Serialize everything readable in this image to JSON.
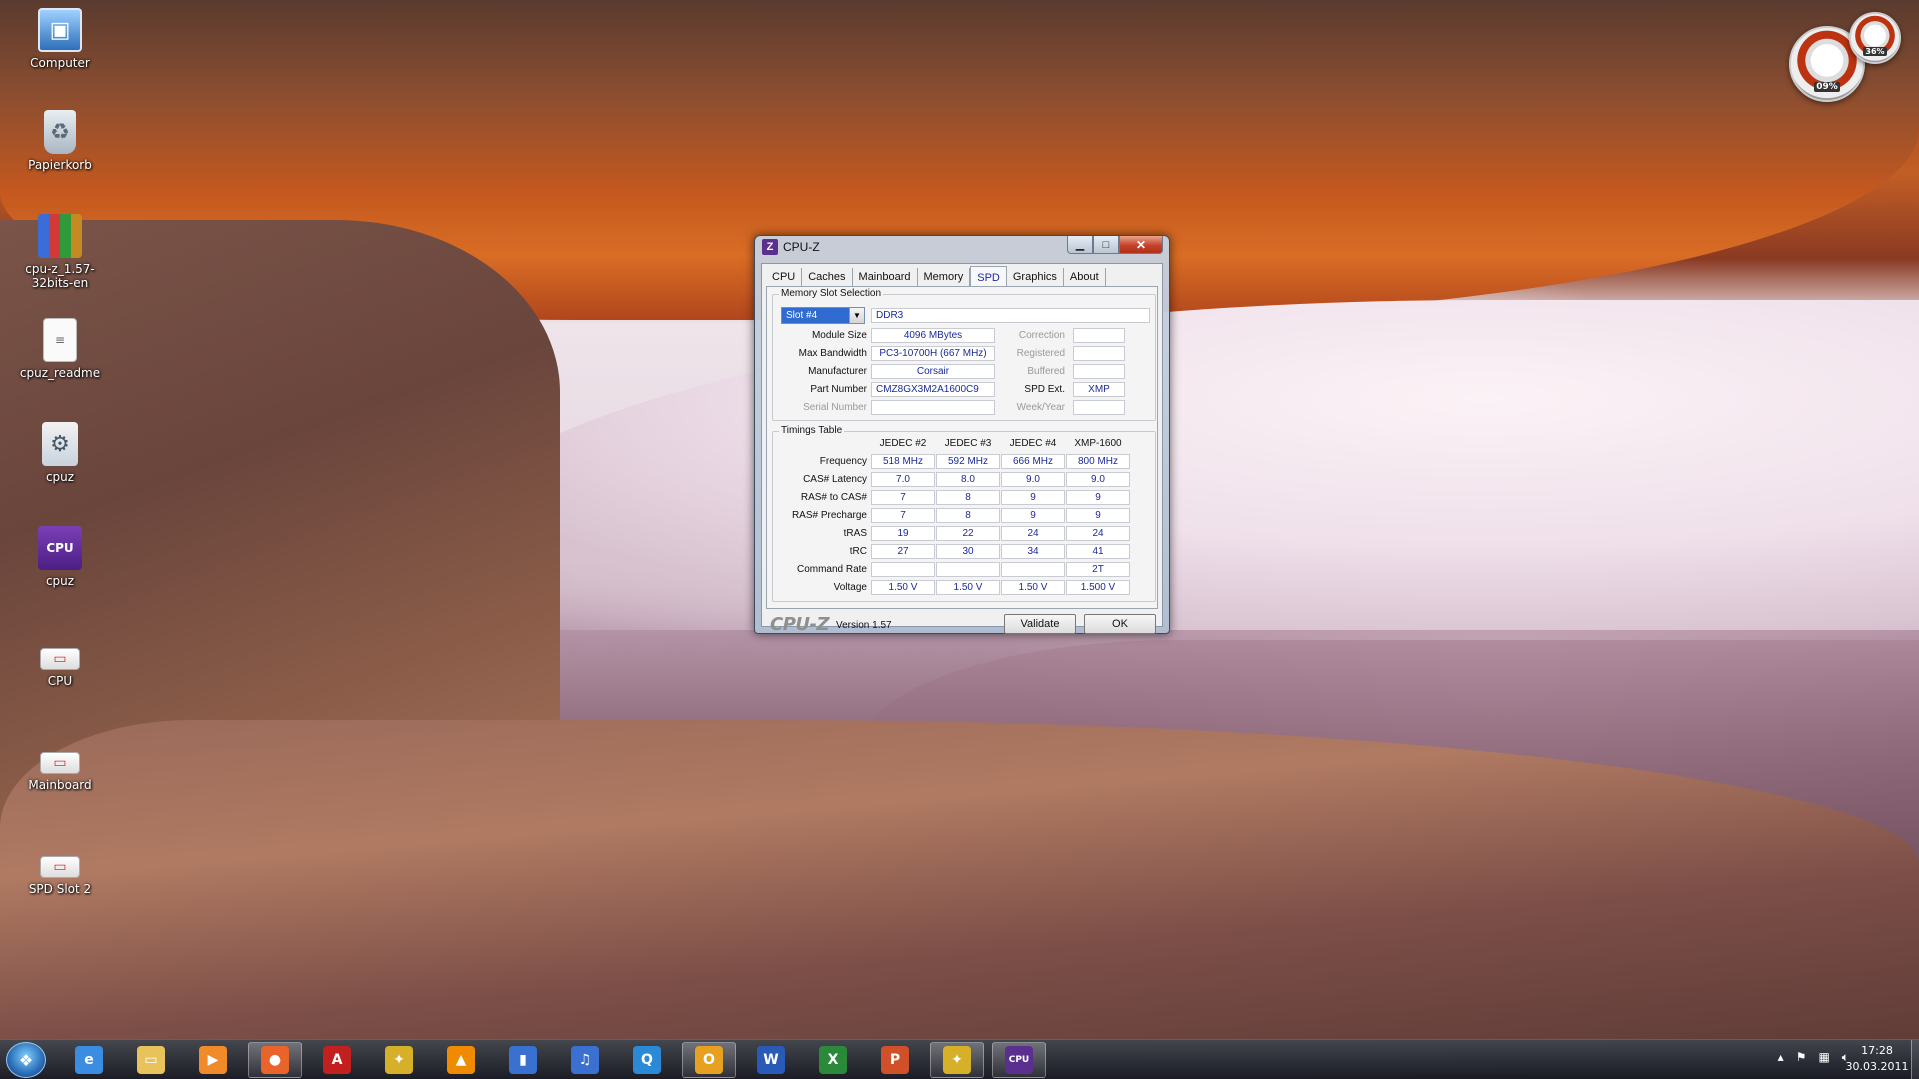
{
  "desktop": {
    "icons": [
      {
        "label": "Computer",
        "icon": "computer-icon"
      },
      {
        "label": "Papierkorb",
        "icon": "recycle-bin-icon"
      },
      {
        "label": "cpu-z_1.57-32bits-en",
        "icon": "winrar-archive-icon"
      },
      {
        "label": "cpuz_readme",
        "icon": "text-document-icon"
      },
      {
        "label": "cpuz",
        "icon": "settings-file-icon"
      },
      {
        "label": "cpuz",
        "icon": "cpuz-app-icon"
      },
      {
        "label": "CPU",
        "icon": "image-shortcut-icon"
      },
      {
        "label": "Mainboard",
        "icon": "image-shortcut-icon"
      },
      {
        "label": "SPD Slot 2",
        "icon": "image-shortcut-icon"
      }
    ]
  },
  "gadget": {
    "cpu_value": "09%",
    "mem_value": "36%"
  },
  "window": {
    "title": "CPU-Z",
    "icon_letter": "Z",
    "tabs": [
      {
        "label": "CPU",
        "active": false
      },
      {
        "label": "Caches",
        "active": false
      },
      {
        "label": "Mainboard",
        "active": false
      },
      {
        "label": "Memory",
        "active": false
      },
      {
        "label": "SPD",
        "active": true
      },
      {
        "label": "Graphics",
        "active": false
      },
      {
        "label": "About",
        "active": false
      }
    ],
    "slot_section": {
      "title": "Memory Slot Selection",
      "selected_slot": "Slot #4",
      "memory_type": "DDR3",
      "labels": {
        "module_size": "Module Size",
        "max_bandwidth": "Max Bandwidth",
        "manufacturer": "Manufacturer",
        "part_number": "Part Number",
        "serial_number": "Serial Number",
        "correction": "Correction",
        "registered": "Registered",
        "buffered": "Buffered",
        "spd_ext": "SPD Ext.",
        "week_year": "Week/Year"
      },
      "values": {
        "module_size": "4096 MBytes",
        "max_bandwidth": "PC3-10700H (667 MHz)",
        "manufacturer": "Corsair",
        "part_number": "CMZ8GX3M2A1600C9",
        "serial_number": "",
        "correction": "",
        "registered": "",
        "buffered": "",
        "spd_ext": "XMP",
        "week_year": ""
      }
    },
    "timings": {
      "title": "Timings Table",
      "columns": [
        "JEDEC #2",
        "JEDEC #3",
        "JEDEC #4",
        "XMP-1600"
      ],
      "rows": [
        {
          "label": "Frequency",
          "values": [
            "518 MHz",
            "592 MHz",
            "666 MHz",
            "800 MHz"
          ]
        },
        {
          "label": "CAS# Latency",
          "values": [
            "7.0",
            "8.0",
            "9.0",
            "9.0"
          ]
        },
        {
          "label": "RAS# to CAS#",
          "values": [
            "7",
            "8",
            "9",
            "9"
          ]
        },
        {
          "label": "RAS# Precharge",
          "values": [
            "7",
            "8",
            "9",
            "9"
          ]
        },
        {
          "label": "tRAS",
          "values": [
            "19",
            "22",
            "24",
            "24"
          ]
        },
        {
          "label": "tRC",
          "values": [
            "27",
            "30",
            "34",
            "41"
          ]
        },
        {
          "label": "Command Rate",
          "values": [
            "",
            "",
            "",
            "2T"
          ]
        },
        {
          "label": "Voltage",
          "values": [
            "1.50 V",
            "1.50 V",
            "1.50 V",
            "1.500 V"
          ]
        }
      ]
    },
    "footer": {
      "logo": "CPU-Z",
      "version": "Version 1.57",
      "validate_label": "Validate",
      "ok_label": "OK"
    }
  },
  "taskbar": {
    "items": [
      {
        "icon": "internet-explorer-icon",
        "glyph": "e",
        "color": "#3a8de0",
        "open": false
      },
      {
        "icon": "windows-explorer-icon",
        "glyph": "▭",
        "color": "#e8c25a",
        "open": false
      },
      {
        "icon": "media-player-icon",
        "glyph": "▶",
        "color": "#f08a2a",
        "open": false
      },
      {
        "icon": "firefox-icon",
        "glyph": "●",
        "color": "#e8642a",
        "open": true
      },
      {
        "icon": "acrobat-reader-icon",
        "glyph": "A",
        "color": "#c21f1f",
        "open": false
      },
      {
        "icon": "tool-app-icon",
        "glyph": "✦",
        "color": "#d7b02a",
        "open": false
      },
      {
        "icon": "vlc-icon",
        "glyph": "▲",
        "color": "#f08a00",
        "open": false
      },
      {
        "icon": "app-icon",
        "glyph": "▮",
        "color": "#3a70d0",
        "open": false
      },
      {
        "icon": "itunes-icon",
        "glyph": "♫",
        "color": "#3a70d0",
        "open": false
      },
      {
        "icon": "search-app-icon",
        "glyph": "Q",
        "color": "#2a8ad8",
        "open": false
      },
      {
        "icon": "outlook-icon",
        "glyph": "O",
        "color": "#e8a020",
        "open": true
      },
      {
        "icon": "word-icon",
        "glyph": "W",
        "color": "#2a5ab8",
        "open": false
      },
      {
        "icon": "excel-icon",
        "glyph": "X",
        "color": "#2a8a3a",
        "open": false
      },
      {
        "icon": "powerpoint-icon",
        "glyph": "P",
        "color": "#d0502a",
        "open": false
      },
      {
        "icon": "tool-app-icon",
        "glyph": "✦",
        "color": "#d7b02a",
        "open": true
      },
      {
        "icon": "cpuz-app-icon",
        "glyph": "CPU",
        "color": "#5a2f8e",
        "open": true
      }
    ],
    "tray": {
      "time": "17:28",
      "date": "30.03.2011"
    }
  }
}
